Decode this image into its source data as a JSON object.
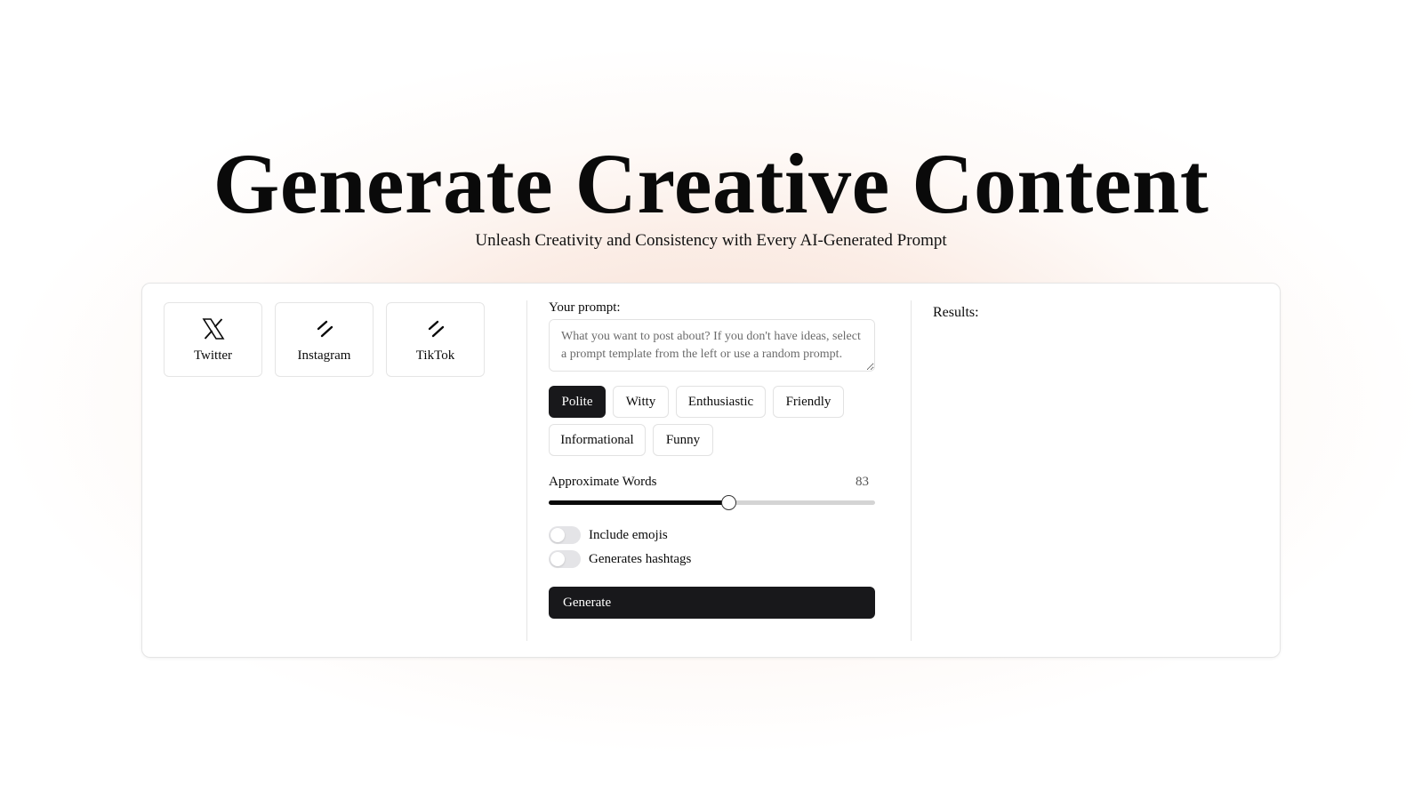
{
  "hero": {
    "title": "Generate Creative Content",
    "subtitle": "Unleash Creativity and Consistency with Every AI-Generated Prompt"
  },
  "platforms": [
    {
      "label": "Twitter",
      "icon": "x-logo-icon"
    },
    {
      "label": "Instagram",
      "icon": "slash-icon"
    },
    {
      "label": "TikTok",
      "icon": "slash-icon"
    }
  ],
  "prompt": {
    "label": "Your prompt:",
    "value": "",
    "placeholder": "What you want to post about? If you don't have ideas, select a prompt template from the left or use a random prompt."
  },
  "tones": {
    "selected": "Polite",
    "options": [
      "Polite",
      "Witty",
      "Enthusiastic",
      "Friendly",
      "Informational",
      "Funny"
    ]
  },
  "words": {
    "label": "Approximate Words",
    "value": "83",
    "slider_fraction": 0.55
  },
  "options": {
    "emojis_label": "Include emojis",
    "emojis_on": false,
    "hashtags_label": "Generates hashtags",
    "hashtags_on": false
  },
  "generate_label": "Generate",
  "results_label": "Results:",
  "colors": {
    "accent": "#18181b",
    "glow": "#f0c4b0"
  }
}
